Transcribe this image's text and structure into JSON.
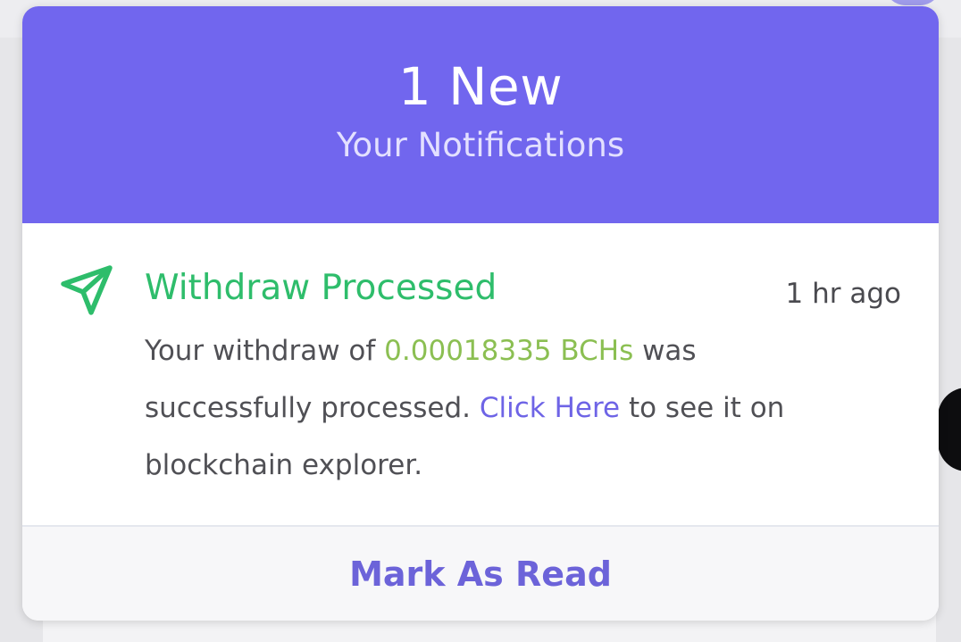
{
  "header": {
    "count_label": "1 New",
    "subtitle": "Your Notifications"
  },
  "notification": {
    "icon": "send-icon",
    "title": "Withdraw Processed",
    "time": "1 hr ago",
    "body_part1": "Your withdraw of ",
    "amount": "0.00018335 BCHs",
    "body_part2": " was successfully processed. ",
    "link_text": "Click Here",
    "body_part3": " to see it on blockchain explorer."
  },
  "footer": {
    "mark_read_label": "Mark As Read"
  },
  "colors": {
    "header_bg": "#7166ee",
    "title_green": "#2ebd6b",
    "amount_green": "#8bbf52",
    "link_purple": "#6e64e6"
  }
}
